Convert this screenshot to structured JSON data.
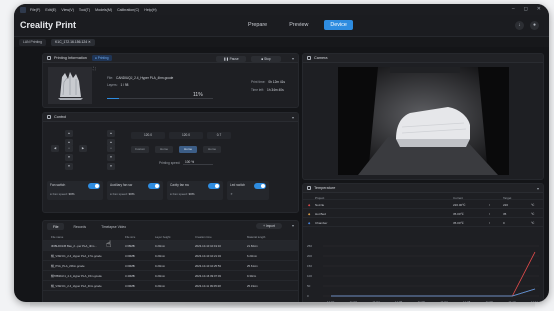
{
  "menu": {
    "items": [
      "File(F)",
      "Edit(E)",
      "View(V)",
      "Tool(T)",
      "Models(M)",
      "Calibration(C)",
      "Help(H)"
    ]
  },
  "window_controls": [
    "–",
    "◻",
    "✕"
  ],
  "app_title": "Creality Print",
  "main_tabs": [
    {
      "label": "Prepare",
      "active": false
    },
    {
      "label": "Preview",
      "active": false
    },
    {
      "label": "Device",
      "active": true
    }
  ],
  "device_row": {
    "first": "LAN Printing",
    "second": "K1C_172.16.156.124 ✕"
  },
  "printing_info": {
    "title": "Printing Information",
    "status": "● Printing",
    "pause_label": "❚❚ Pause",
    "stop_label": "■ Stop",
    "file_label": "File:",
    "file_name": "CANDIUQJ_2.4_Hyper PLA_4hm.gcode",
    "layers_label": "Layers:",
    "layers_value": "1 / 98",
    "progress_text": "11%",
    "progress_fraction": 0.11,
    "print_time_label": "Print time:",
    "print_time_value": "0h 12m 41s",
    "time_left_label": "Time left:",
    "time_left_value": "1h 34m 40s"
  },
  "control": {
    "title": "Control",
    "x_value": "120.0",
    "y_value": "120.0",
    "z_value": "0.7",
    "buttons": [
      {
        "label": "Custom",
        "active": false
      },
      {
        "label": "Home",
        "active": false
      },
      {
        "label": "Home",
        "active": true
      },
      {
        "label": "Home",
        "active": false
      }
    ],
    "speed_label": "Printing speed:",
    "speed_value": "100 %",
    "fans": [
      {
        "name": "Fan switch",
        "speed_label": "Fan speed:",
        "speed": "30%"
      },
      {
        "name": "Auxiliary fan sw",
        "speed_label": "Fan speed:",
        "speed": "30%"
      },
      {
        "name": "Cavity fan sw",
        "speed_label": "Fan speed:",
        "speed": "30%"
      },
      {
        "name": "Led switch",
        "speed_label": "",
        "speed": ""
      }
    ]
  },
  "files": {
    "tabs": [
      {
        "label": "File",
        "active": true
      },
      {
        "label": "Records",
        "active": false
      },
      {
        "label": "Timelapse Video",
        "active": false
      }
    ],
    "import_label": "+ Import",
    "headers": [
      "File name",
      "File size",
      "Layer height",
      "Creation time",
      "Material length"
    ],
    "rows": [
      [
        "3DBLD0145 Bas_2...per PLA_4hm...",
        "3.68MB",
        "0.20mm",
        "2023-10-10 10:19:16",
        "21.82cm"
      ],
      [
        "棋_V3W-K1_2.4_Hyper PLA_17m.gcode",
        "3.09MB",
        "0.20mm",
        "2023-10-10 10:21:34",
        "6.23mm"
      ],
      [
        "棋_PVA_PLA_20hm.gcode",
        "3.09MB",
        "0.20mm",
        "2023-10-10 10:25:53",
        "25.61cm"
      ],
      [
        "棋78839-K1_2.4_Hyper PLA_15m.gcode",
        "3.40MB",
        "0.20mm",
        "2023-10-16 09:07:03",
        "9.30cm"
      ],
      [
        "棋_V3W-K1_2.4_Hyper PLA_4hm.gcode",
        "3.09MB",
        "0.20mm",
        "2023-10-11 09:05:28",
        "25.19cm"
      ]
    ]
  },
  "camera": {
    "title": "Camera"
  },
  "temperature": {
    "title": "Temperature",
    "headers": [
      "Project",
      "Current",
      "Target"
    ],
    "rows": [
      {
        "name": "Nozzle",
        "current": "220.00℃",
        "target": "220",
        "unit": "℃",
        "color": "#e84c4c"
      },
      {
        "name": "Hot Bed",
        "current": "35.00℃",
        "target": "35",
        "unit": "℃",
        "color": "#e8a84c"
      },
      {
        "name": "Chamber",
        "current": "35.00℃",
        "target": "0",
        "unit": "℃",
        "color": "#4c8ce8"
      }
    ],
    "chart_data": {
      "type": "line",
      "y_ticks": [
        "250",
        "200",
        "150",
        "100",
        "50",
        "0"
      ],
      "x_ticks": [
        "11:02",
        "11:03",
        "11:04",
        "11:05",
        "11:06",
        "11:07",
        "11:08",
        "11:09",
        "11:10",
        "11:11"
      ],
      "ylim": [
        0,
        250
      ],
      "series": [
        {
          "values": [
            0,
            0,
            0,
            0,
            0,
            0,
            0,
            0,
            0,
            220
          ],
          "color": "#e84c4c"
        },
        {
          "values": [
            0,
            0,
            0,
            0,
            0,
            0,
            0,
            0,
            0,
            35
          ],
          "color": "#e8a84c"
        },
        {
          "values": [
            0,
            0,
            0,
            0,
            0,
            0,
            0,
            0,
            0,
            35
          ],
          "color": "#4c8ce8"
        }
      ]
    }
  },
  "colors": {
    "accent": "#2e8ce0",
    "background": "#141518",
    "panel": "#1e1f23"
  }
}
